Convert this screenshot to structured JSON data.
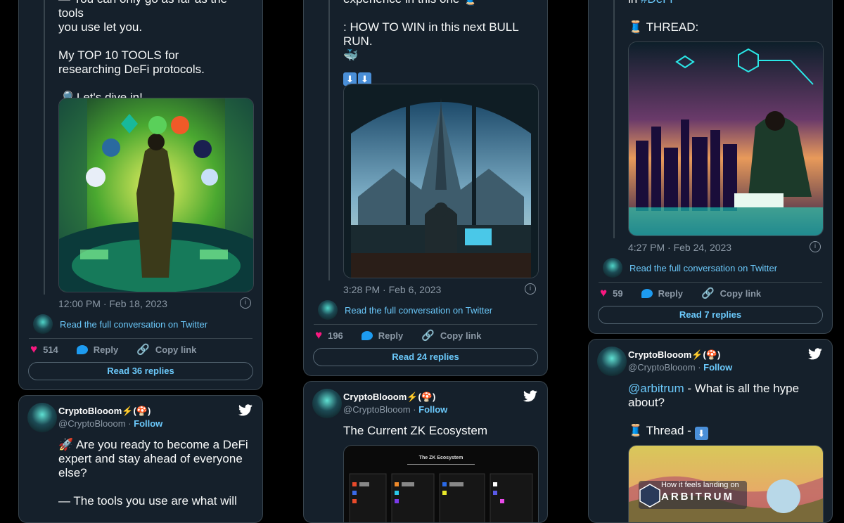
{
  "colors": {
    "background": "#000000",
    "card": "#15202b",
    "border": "#38444d",
    "link": "#6bc9fb",
    "like": "#f91880",
    "reply": "#1d9bf0",
    "muted": "#8b98a5"
  },
  "card1": {
    "text_partial": "— You can only go as far as the tools",
    "text_line2": "you use let you.",
    "text_tools": "My TOP 10 TOOLS for researching DeFi protocols.",
    "text_dive": "🔎 Let's dive in!",
    "timestamp": "12:00 PM · Feb 18, 2023",
    "conversation": "Read the full conversation on Twitter",
    "likes": "514",
    "reply_label": "Reply",
    "copy_label": "Copy link",
    "read_replies": "Read 36 replies"
  },
  "card2": {
    "text_partial": "experience in this one 🧵",
    "text_win": ": HOW TO WIN in this next BULL RUN.",
    "text_emoji": "🐳",
    "arrows": [
      "⬇",
      "⬇"
    ],
    "timestamp": "3:28 PM · Feb 6, 2023",
    "conversation": "Read the full conversation on Twitter",
    "likes": "196",
    "reply_label": "Reply",
    "copy_label": "Copy link",
    "read_replies": "Read 24 replies"
  },
  "card3": {
    "text_partial": "in ",
    "text_partial_tag": "#DeFi",
    "text_thread": "🧵 THREAD:",
    "timestamp": "4:27 PM · Feb 24, 2023",
    "conversation": "Read the full conversation on Twitter",
    "likes": "59",
    "reply_label": "Reply",
    "copy_label": "Copy link",
    "read_replies": "Read 7 replies"
  },
  "card4": {
    "name": "CryptoBlooom⚡(🍄)",
    "handle": "@CryptoBlooom",
    "dot": " · ",
    "follow": "Follow",
    "text_line1": "🚀 Are you ready to become a DeFi",
    "text_line2": "expert and stay ahead of everyone",
    "text_line3": "else?",
    "text_line4": "— The tools you use are what will"
  },
  "card5": {
    "name": "CryptoBlooom⚡(🍄)",
    "handle": "@CryptoBlooom",
    "dot": " · ",
    "follow": "Follow",
    "text": "The Current ZK Ecosystem",
    "image_title": "The ZK Ecosystem"
  },
  "card6": {
    "name": "CryptoBlooom⚡(🍄)",
    "handle": "@CryptoBlooom",
    "dot": " · ",
    "follow": "Follow",
    "mention": "@arbitrum",
    "text_rest": " - What is all the hype about?",
    "text_thread": "🧵 Thread - ",
    "arrow": "⬇",
    "image_caption": "How it feels landing on",
    "image_brand": "ARBITRUM"
  },
  "icons": [
    "twitter-bird-icon",
    "heart-icon",
    "reply-icon",
    "link-icon",
    "info-icon"
  ]
}
